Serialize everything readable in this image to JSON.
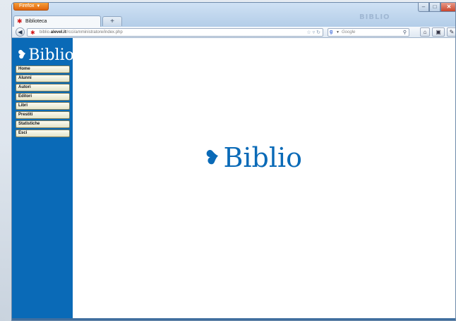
{
  "browser": {
    "menu_button": "Firefox",
    "ghost_brand": "BIBLIO",
    "tab_title": "Biblioteca",
    "new_tab": "+",
    "url_prefix": "biblio.",
    "url_domain": "alevel.it",
    "url_path": "/rcci/amministratore/index.php",
    "search_placeholder": "Google",
    "window_controls": {
      "minimize": "–",
      "maximize": "□",
      "close": "✕"
    }
  },
  "sidebar": {
    "logo": "Biblio",
    "items": [
      {
        "label": "Home"
      },
      {
        "label": "Alunni"
      },
      {
        "label": "Autori"
      },
      {
        "label": "Editori"
      },
      {
        "label": "Libri"
      },
      {
        "label": "Prestiti"
      },
      {
        "label": "Statistiche"
      },
      {
        "label": "Esci"
      }
    ]
  },
  "main": {
    "logo": "Biblio"
  },
  "icons": {
    "back": "arrow-left-icon",
    "favicon": "asterisk-icon",
    "home": "home-icon",
    "bookmarks": "bookmark-icon",
    "addon": "puzzle-icon",
    "logo_mark": "drop-icon"
  },
  "colors": {
    "brand_blue": "#0a6ab7",
    "firefox_orange": "#e0640c"
  }
}
